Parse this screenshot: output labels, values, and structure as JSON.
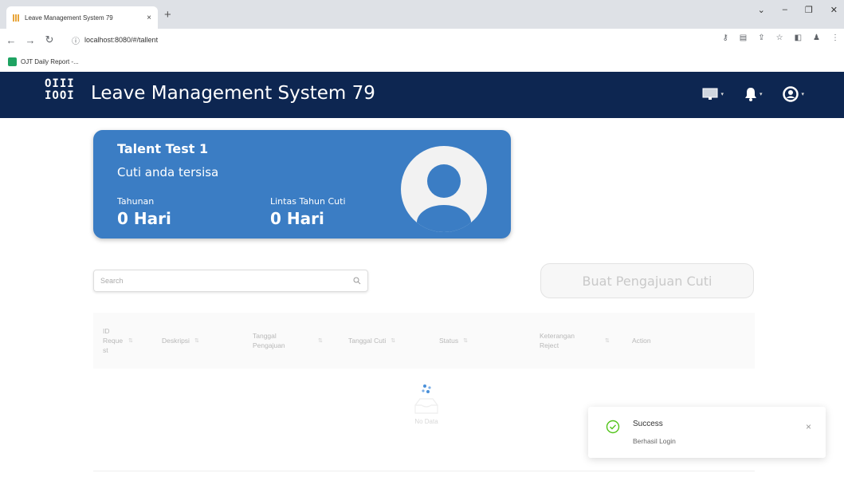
{
  "browser": {
    "tab_title": "Leave Management System 79",
    "tab_close": "×",
    "new_tab": "+",
    "url": "localhost:8080/#/tallent",
    "bookmark": "OJT Daily Report -..."
  },
  "app": {
    "logo": "OIII\nIOOI",
    "title": "Leave Management System 79"
  },
  "card": {
    "name": "Talent Test 1",
    "subtitle": "Cuti anda tersisa",
    "annual_label": "Tahunan",
    "annual_value": "0 Hari",
    "carry_label": "Lintas Tahun Cuti",
    "carry_value": "0 Hari"
  },
  "search": {
    "placeholder": "Search"
  },
  "create_button": "Buat Pengajuan Cuti",
  "table": {
    "columns": [
      "ID Reque st",
      "Deskripsi",
      "Tanggal Pengajuan",
      "Tanggal Cuti",
      "Status",
      "Keterangan Reject",
      "Action"
    ],
    "empty_text": "No Data"
  },
  "toast": {
    "title": "Success",
    "message": "Berhasil Login",
    "close": "×",
    "color": "#52c41a"
  },
  "colors": {
    "header": "#0d2651",
    "card": "#3b7dc4"
  }
}
